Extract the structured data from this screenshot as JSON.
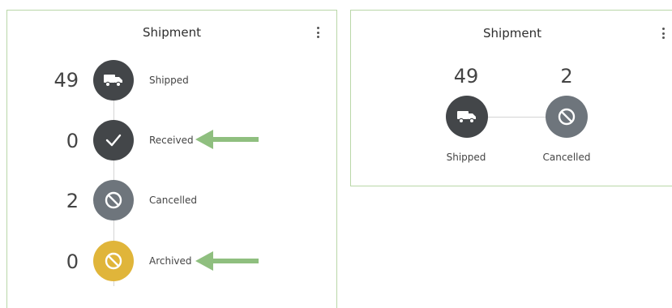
{
  "left_card": {
    "title": "Shipment",
    "statuses": [
      {
        "count": "49",
        "label": "Shipped",
        "icon": "truck-icon",
        "color": "#434649"
      },
      {
        "count": "0",
        "label": "Received",
        "icon": "check-icon",
        "color": "#434649"
      },
      {
        "count": "2",
        "label": "Cancelled",
        "icon": "cancel-icon",
        "color": "#6e757c"
      },
      {
        "count": "0",
        "label": "Archived",
        "icon": "cancel-icon",
        "color": "#e0b53a"
      }
    ]
  },
  "right_card": {
    "title": "Shipment",
    "statuses": [
      {
        "count": "49",
        "label": "Shipped",
        "icon": "truck-icon",
        "color": "#434649"
      },
      {
        "count": "2",
        "label": "Cancelled",
        "icon": "cancel-icon",
        "color": "#6e757c"
      }
    ]
  },
  "annotation_arrows": {
    "color": "#8fbf7f",
    "points_to": [
      "Received",
      "Archived"
    ]
  }
}
